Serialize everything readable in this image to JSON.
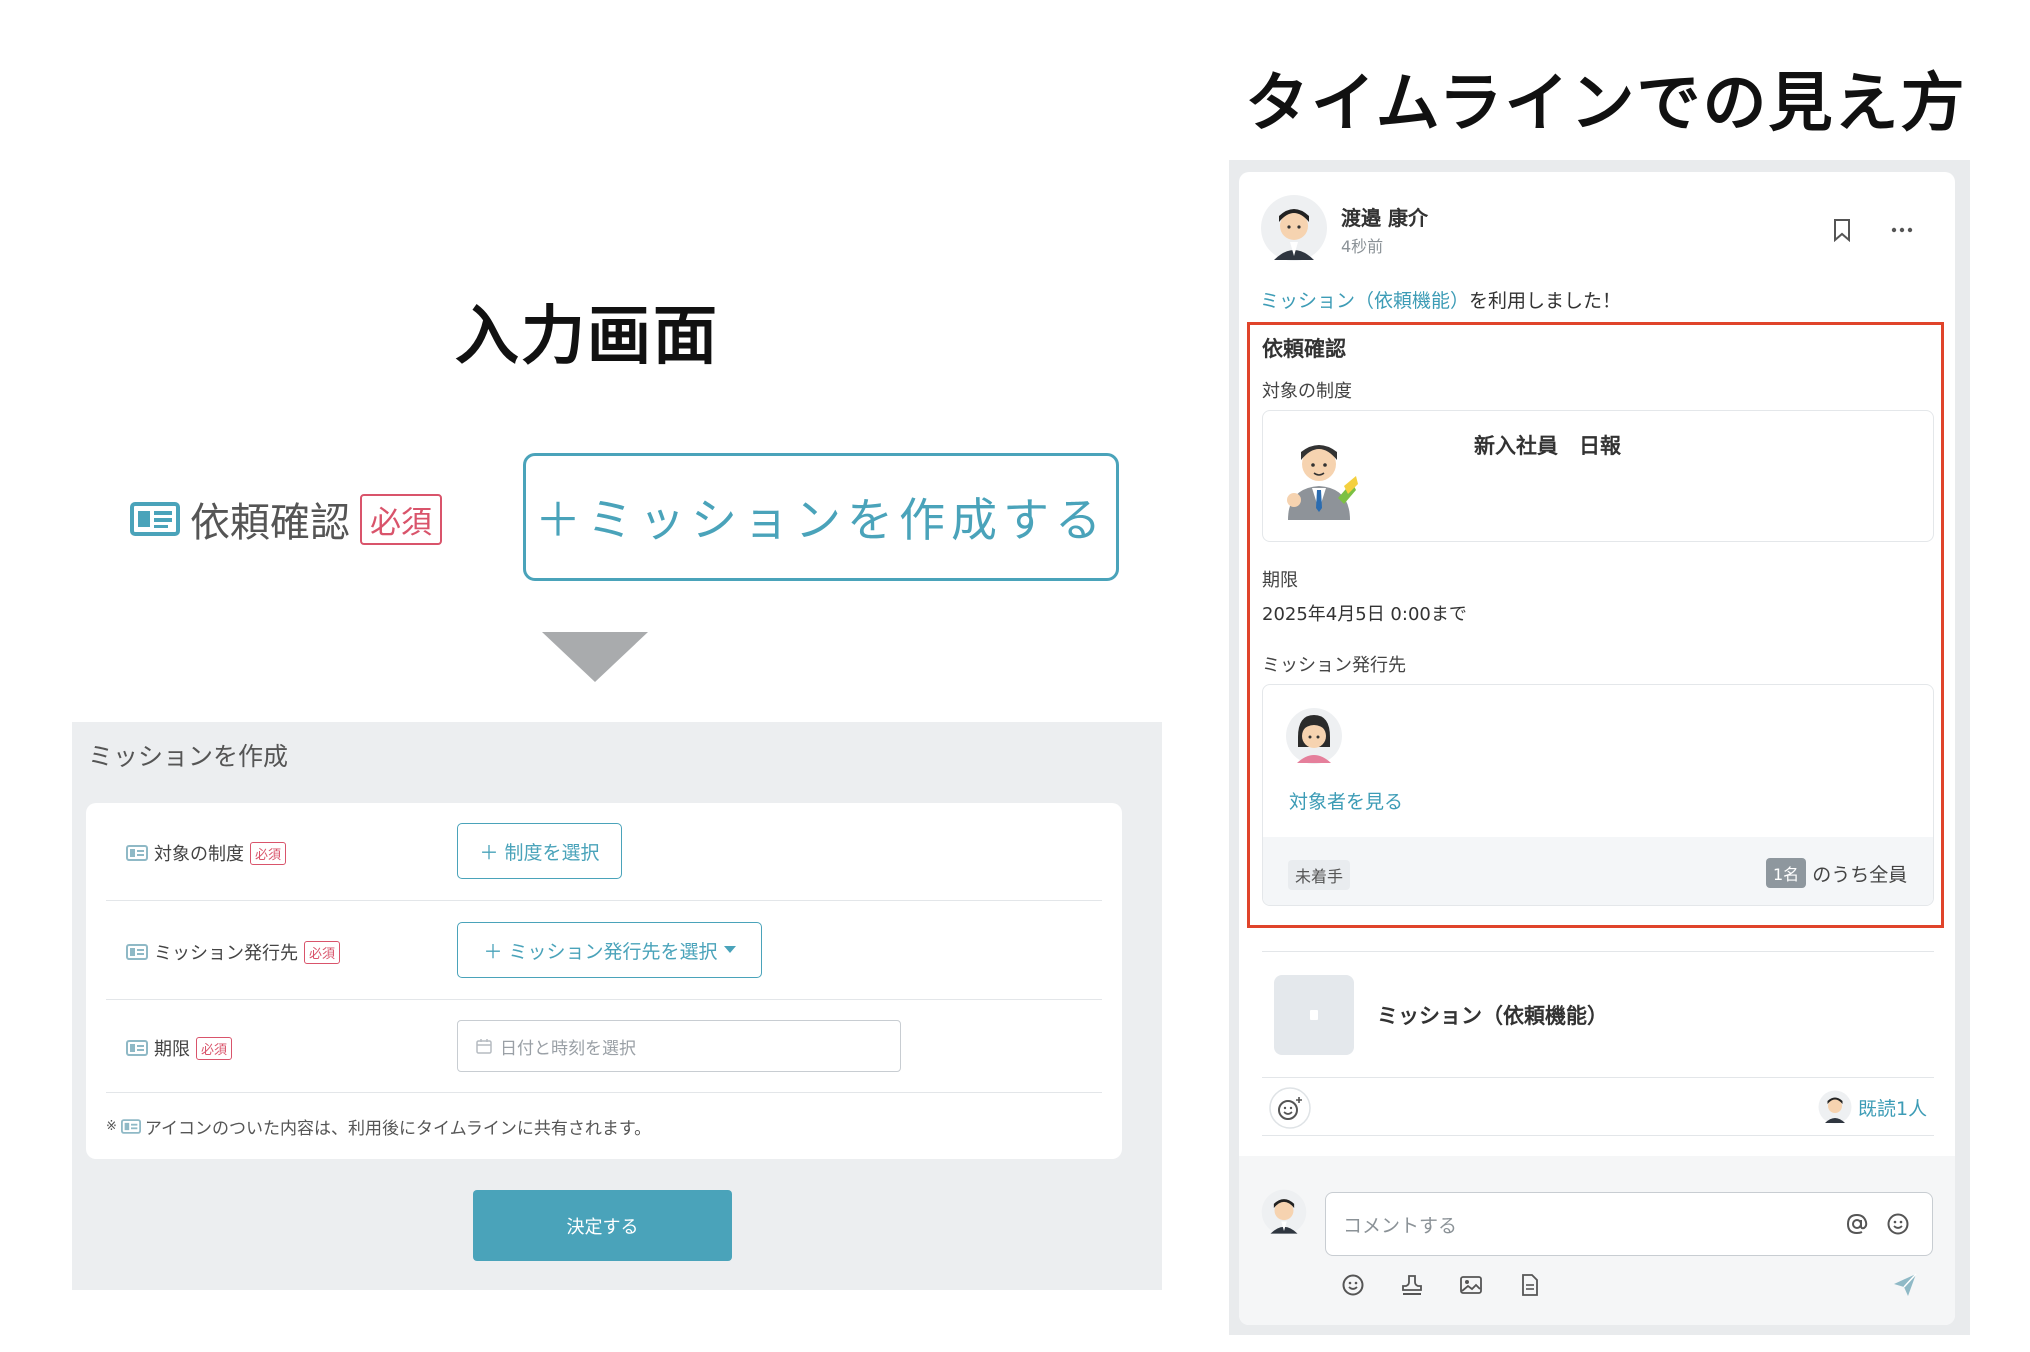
{
  "headings": {
    "input_screen": "入力画面",
    "timeline_view": "タイムラインでの見え方"
  },
  "big_row": {
    "label": "依頼確認",
    "required": "必須",
    "create_button": "＋ミッションを作成する"
  },
  "form": {
    "title": "ミッションを作成",
    "rows": [
      {
        "label": "対象の制度",
        "required": "必須",
        "button": "制度を選択"
      },
      {
        "label": "ミッション発行先",
        "required": "必須",
        "button": "ミッション発行先を選択"
      },
      {
        "label": "期限",
        "required": "必須",
        "placeholder": "日付と時刻を選択"
      }
    ],
    "note_prefix": "※",
    "note": "アイコンのついた内容は、利用後にタイムラインに共有されます。",
    "submit": "決定する"
  },
  "post": {
    "author": "渡邉 康介",
    "time": "4秒前",
    "intro_link": "ミッション（依頼機能）",
    "intro_text": "を利用しました！",
    "section_title": "依頼確認",
    "target_label": "対象の制度",
    "system_name": "新入社員　日報",
    "deadline_label": "期限",
    "deadline_value": "2025年4月5日 0:00まで",
    "recipients_label": "ミッション発行先",
    "view_targets": "対象者を見る",
    "status": "未着手",
    "count": "1名",
    "count_suffix": "のうち全員",
    "app_name": "ミッション（依頼機能）",
    "read_count": "既読1人",
    "comment_placeholder": "コメントする"
  },
  "colors": {
    "accent": "#4aa3ba",
    "required": "#d9546b",
    "highlight": "#e0442a"
  },
  "icons": [
    "id-card-icon",
    "plus-icon",
    "caret-down-icon",
    "calendar-icon",
    "bookmark-icon",
    "more-icon",
    "emoji-add-icon",
    "at-icon",
    "emoji-icon",
    "stamp-icon",
    "image-icon",
    "file-icon",
    "send-icon",
    "arrow-down-icon"
  ]
}
